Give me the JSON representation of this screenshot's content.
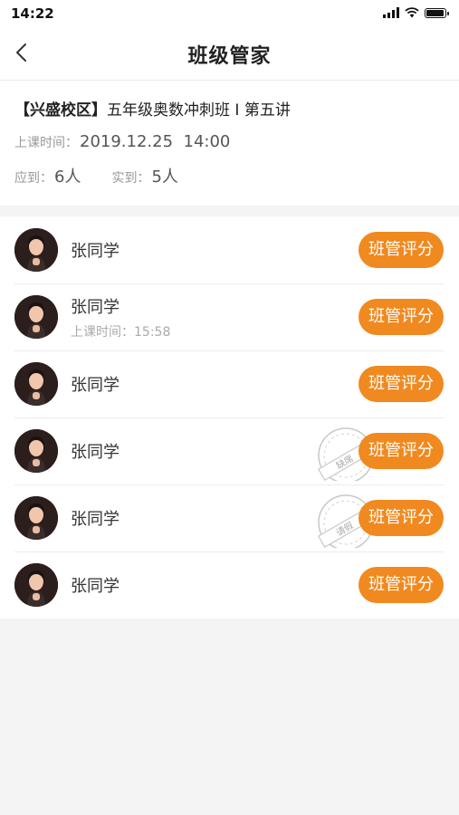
{
  "status_bar": {
    "time": "14:22"
  },
  "nav": {
    "title": "班级管家"
  },
  "class_info": {
    "campus": "【兴盛校区】",
    "course": "五年级奥数冲刺班 I 第五讲",
    "start_label": "上课时间：",
    "start_value": "2019.12.25  14:00",
    "expected_label": "应到：",
    "expected_value": "6人",
    "actual_label": "实到：",
    "actual_value": "5人"
  },
  "students": [
    {
      "name": "张同学",
      "sub": "",
      "stamp": "",
      "button": "班管评分"
    },
    {
      "name": "张同学",
      "sub": "上课时间：15:58",
      "stamp": "",
      "button": "班管评分"
    },
    {
      "name": "张同学",
      "sub": "",
      "stamp": "",
      "button": "班管评分"
    },
    {
      "name": "张同学",
      "sub": "",
      "stamp": "缺席",
      "button": "班管评分"
    },
    {
      "name": "张同学",
      "sub": "",
      "stamp": "请假",
      "button": "班管评分"
    },
    {
      "name": "张同学",
      "sub": "",
      "stamp": "",
      "button": "班管评分"
    }
  ],
  "colors": {
    "accent": "#f0891f"
  }
}
